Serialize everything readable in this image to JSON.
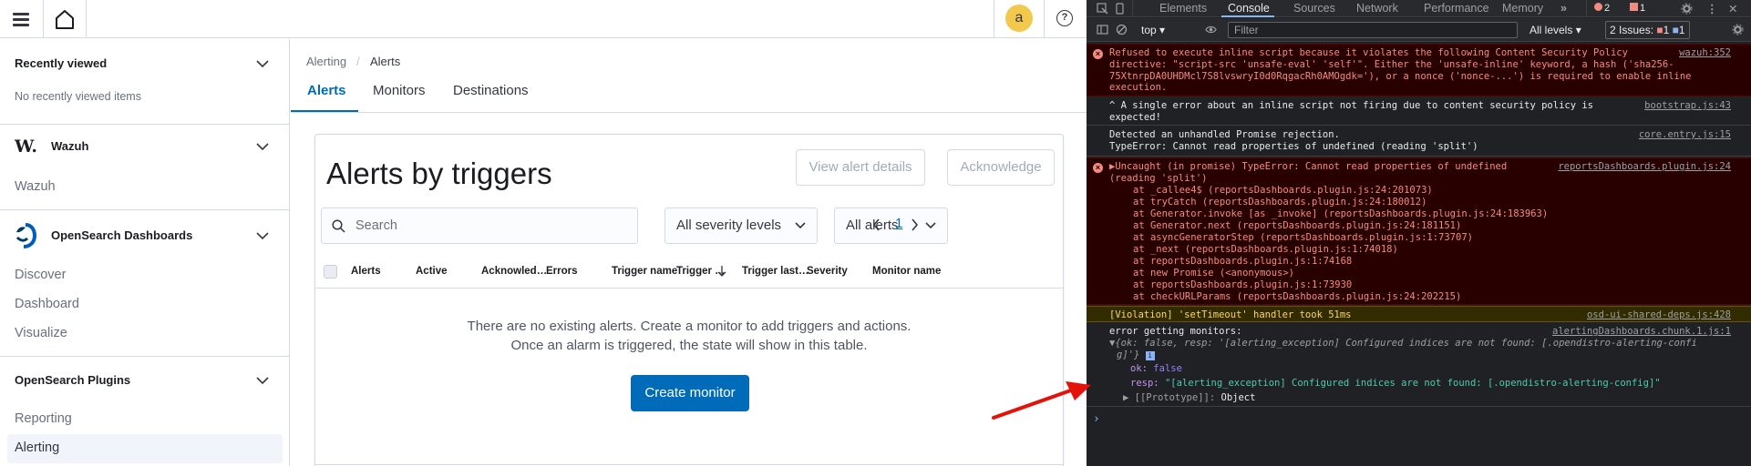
{
  "topbar": {
    "avatar_letter": "a",
    "help_label": "?"
  },
  "sidebar": {
    "recently_viewed": {
      "title": "Recently viewed",
      "empty": "No recently viewed items"
    },
    "wazuh": {
      "title": "Wazuh",
      "logo_text": "W.",
      "items": [
        "Wazuh"
      ]
    },
    "opensearch": {
      "title": "OpenSearch Dashboards",
      "items": [
        "Discover",
        "Dashboard",
        "Visualize"
      ]
    },
    "plugins": {
      "title": "OpenSearch Plugins",
      "items": [
        "Reporting",
        "Alerting"
      ],
      "active": "Alerting"
    }
  },
  "breadcrumb": {
    "parent": "Alerting",
    "separator": "/",
    "current": "Alerts"
  },
  "tabs": [
    {
      "label": "Alerts",
      "active": true
    },
    {
      "label": "Monitors",
      "active": false
    },
    {
      "label": "Destinations",
      "active": false
    }
  ],
  "panel": {
    "title": "Alerts by triggers",
    "view_details_label": "View alert details",
    "acknowledge_label": "Acknowledge",
    "search_placeholder": "Search",
    "severity_select": "All severity levels",
    "state_select": "All alerts",
    "page_number": "1",
    "columns": [
      "Alerts",
      "Active",
      "Acknowled…",
      "Errors",
      "Trigger name",
      "Trigger …",
      "Trigger last…",
      "Severity",
      "Monitor name"
    ],
    "empty_line1": "There are no existing alerts. Create a monitor to add triggers and actions.",
    "empty_line2": "Once an alarm is triggered, the state will show in this table.",
    "create_monitor_label": "Create monitor"
  },
  "devtools": {
    "tabs": [
      "Elements",
      "Console",
      "Sources",
      "Network",
      "Performance",
      "Memory"
    ],
    "active_tab": "Console",
    "error_count": "2",
    "warning_count": "1",
    "context": "top",
    "filter_placeholder": "Filter",
    "levels": "All levels",
    "issues_label": "2 Issues:",
    "issues_errors": "1",
    "issues_info": "1",
    "messages": [
      {
        "type": "error",
        "text": "Refused to execute inline script because it violates the following Content Security Policy\ndirective: \"script-src 'unsafe-eval' 'self'\". Either the 'unsafe-inline' keyword, a hash ('sha256-\n75XtnrpDA0UHDMcl7S8lvswryI0d0RqgacRh0AMOgdk='), or a nonce ('nonce-...') is required to enable inline\nexecution.",
        "source": "wazuh:352"
      },
      {
        "type": "plain",
        "text": "^ A single error about an inline script not firing due to content security policy is\nexpected!",
        "source": "bootstrap.js:43"
      },
      {
        "type": "plain",
        "text": "Detected an unhandled Promise rejection.\nTypeError: Cannot read properties of undefined (reading 'split')",
        "source": "core.entry.js:15"
      },
      {
        "type": "error",
        "text": "▶Uncaught (in promise) TypeError: Cannot read properties of undefined\n(reading 'split')",
        "source": "reportsDashboards.plugin.js:24"
      },
      {
        "type": "warning",
        "text": "[Violation] 'setTimeout' handler took 51ms",
        "source": "osd-ui-shared-deps.js:428"
      },
      {
        "type": "plain",
        "text": "error getting monitors:",
        "source": "alertingDashboards.chunk.1.js:1"
      }
    ],
    "stack": [
      "at _callee4$ (reportsDashboards.plugin.js:24:201073)",
      "at tryCatch (reportsDashboards.plugin.js:24:180012)",
      "at Generator.invoke [as _invoke] (reportsDashboards.plugin.js:24:183963)",
      "at Generator.next (reportsDashboards.plugin.js:24:181151)",
      "at asyncGeneratorStep (reportsDashboards.plugin.js:1:73707)",
      "at _next (reportsDashboards.plugin.js:1:74018)",
      "at reportsDashboards.plugin.js:1:74168",
      "at new Promise (<anonymous>)",
      "at reportsDashboards.plugin.js:1:73930",
      "at checkURLParams (reportsDashboards.plugin.js:24:202215)"
    ],
    "object": {
      "summary_line1": "{ok: false, resp: '[alerting_exception] Configured indices are not found: [.opendistro-alerting-confi",
      "summary_line2": "g]'}",
      "ok_key": "ok:",
      "ok_value": "false",
      "resp_key": "resp:",
      "resp_value": "\"[alerting_exception] Configured indices are not found: [.opendistro-alerting-config]\"",
      "proto_key": "[[Prototype]]:",
      "proto_value": "Object"
    },
    "prompt": "›"
  },
  "colors": {
    "accent": "#006bb8",
    "error_bg": "#290000",
    "warning_bg": "#332b00",
    "annotation_arrow": "#e3120b"
  }
}
